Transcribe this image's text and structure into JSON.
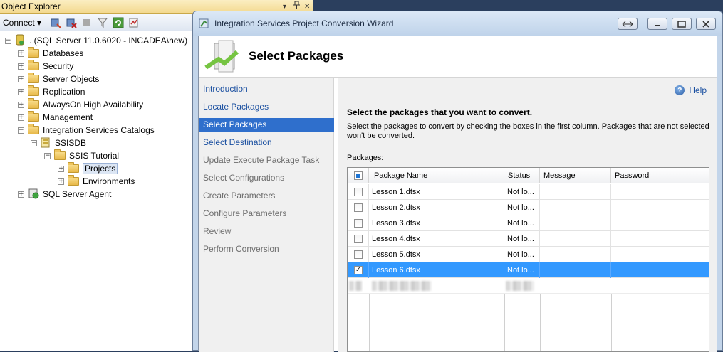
{
  "object_explorer": {
    "title": "Object Explorer",
    "pin_icon": "pin-icon",
    "close_glyph": "✕",
    "dropdown_glyph": "▾",
    "toolbar": {
      "connect_label": "Connect ▾"
    },
    "tree": {
      "server": ". (SQL Server 11.0.6020 - INCADEA\\hew)",
      "databases": "Databases",
      "security": "Security",
      "server_objects": "Server Objects",
      "replication": "Replication",
      "alwayson": "AlwaysOn High Availability",
      "management": "Management",
      "isc": "Integration Services Catalogs",
      "ssisdb": "SSISDB",
      "ssis_tutorial": "SSIS Tutorial",
      "projects": "Projects",
      "environments": "Environments",
      "sql_agent": "SQL Server Agent"
    }
  },
  "wizard": {
    "title": "Integration Services Project Conversion Wizard",
    "header_title": "Select Packages",
    "nav": [
      "Introduction",
      "Locate Packages",
      "Select Packages",
      "Select Destination",
      "Update Execute Package Task",
      "Select Configurations",
      "Create Parameters",
      "Configure Parameters",
      "Review",
      "Perform Conversion"
    ],
    "help_label": "Help",
    "heading": "Select the packages that you want to convert.",
    "description": "Select the packages to convert by checking the boxes in the first column. Packages that are not selected won't be converted.",
    "packages_label": "Packages:",
    "columns": [
      "Package Name",
      "Status",
      "Message",
      "Password"
    ],
    "rows": [
      {
        "name": "Lesson 1.dtsx",
        "status": "Not lo...",
        "message": "",
        "password": ""
      },
      {
        "name": "Lesson 2.dtsx",
        "status": "Not lo...",
        "message": "",
        "password": ""
      },
      {
        "name": "Lesson 3.dtsx",
        "status": "Not lo...",
        "message": "",
        "password": ""
      },
      {
        "name": "Lesson 4.dtsx",
        "status": "Not lo...",
        "message": "",
        "password": ""
      },
      {
        "name": "Lesson 5.dtsx",
        "status": "Not lo...",
        "message": "",
        "password": ""
      },
      {
        "name": "Lesson 6.dtsx",
        "status": "Not lo...",
        "message": "",
        "password": ""
      }
    ],
    "check_glyph": "✓"
  },
  "colors": {
    "nav_active": "#2f6fcc",
    "row_selected": "#3399ff",
    "link": "#1a4fa0"
  }
}
